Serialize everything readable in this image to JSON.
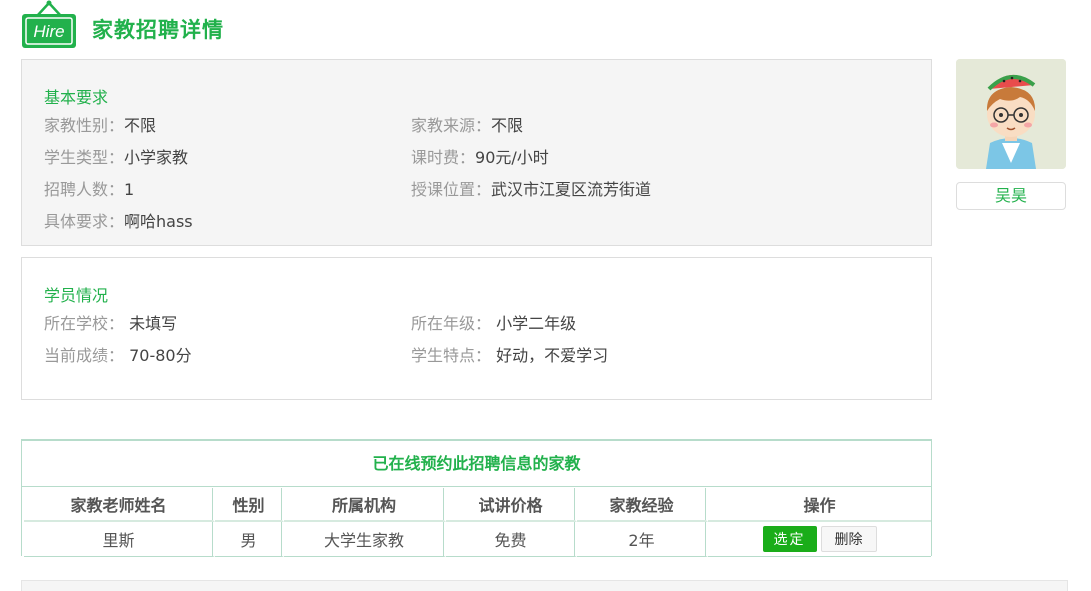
{
  "header": {
    "logo_text": "Hire",
    "title": "家教招聘详情"
  },
  "basic": {
    "heading": "基本要求",
    "fields": [
      {
        "label": "家教性别：",
        "value": "不限"
      },
      {
        "label": "家教来源：",
        "value": "不限"
      },
      {
        "label": "学生类型：",
        "value": "小学家教"
      },
      {
        "label": "课时费：",
        "value": "90元/小时"
      },
      {
        "label": "招聘人数：",
        "value": "1"
      },
      {
        "label": "授课位置：",
        "value": "武汉市江夏区流芳街道"
      },
      {
        "label": "具体要求：",
        "value": "啊哈hass"
      }
    ]
  },
  "student": {
    "heading": "学员情况",
    "fields": [
      {
        "label": "所在学校：",
        "value": "未填写"
      },
      {
        "label": "所在年级：",
        "value": "小学二年级"
      },
      {
        "label": "当前成绩：",
        "value": "70-80分"
      },
      {
        "label": "学生特点：",
        "value": "好动，不爱学习"
      }
    ]
  },
  "profile": {
    "name": "吴昊"
  },
  "booked": {
    "title": "已在线预约此招聘信息的家教",
    "columns": [
      "家教老师姓名",
      "性别",
      "所属机构",
      "试讲价格",
      "家教经验",
      "操作"
    ],
    "rows": [
      {
        "name": "里斯",
        "gender": "男",
        "org": "大学生家教",
        "price": "免费",
        "experience": "2年"
      }
    ],
    "select_label": "选定",
    "delete_label": "删除"
  },
  "colors": {
    "accent": "#22b14c",
    "panel_bg": "#f5f5f5",
    "label": "#999999",
    "button_green": "#1aad19"
  }
}
